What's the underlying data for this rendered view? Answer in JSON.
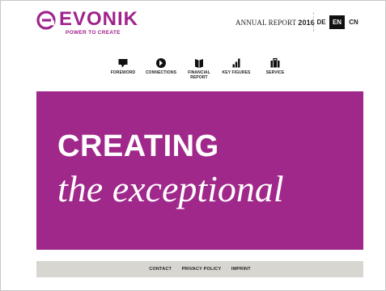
{
  "header": {
    "logo_text": "EVONIK",
    "logo_tagline": "POWER TO CREATE",
    "report_title_prefix": "ANNUAL REPORT",
    "report_year": "2016",
    "languages": [
      {
        "code": "DE",
        "active": false
      },
      {
        "code": "EN",
        "active": true
      },
      {
        "code": "CN",
        "active": false
      }
    ]
  },
  "nav": {
    "items": [
      {
        "label": "FOREWORD",
        "icon": "speech-bubble-icon"
      },
      {
        "label": "CONNECTIONS",
        "icon": "connections-icon"
      },
      {
        "label_line1": "FINANCIAL",
        "label_line2": "REPORT",
        "icon": "book-icon"
      },
      {
        "label": "KEY FIGURES",
        "icon": "bar-chart-icon"
      },
      {
        "label": "SERVICE",
        "icon": "briefcase-icon"
      }
    ]
  },
  "hero": {
    "line1": "CREATING",
    "line2": "the exceptional",
    "background_color": "#a0288b"
  },
  "footer": {
    "links": [
      "CONTACT",
      "PRIVACY POLICY",
      "IMPRINT"
    ]
  },
  "colors": {
    "brand": "#a0238c",
    "footer_bg": "#d8d6d0"
  }
}
